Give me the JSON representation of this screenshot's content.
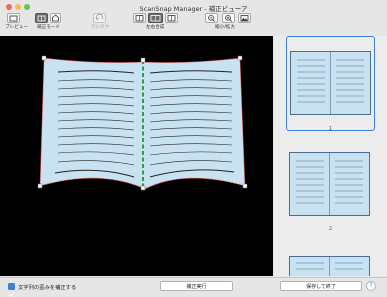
{
  "window": {
    "title": "ScanSnap Manager - 補正ビューア"
  },
  "toolbar": {
    "preview_label": "プレビュー",
    "correction_mode_label": "補正モード",
    "undo_label": "元に戻す",
    "page_compose_label": "左右合成",
    "zoom_label": "縮小/拡大"
  },
  "thumbnails": {
    "items": [
      {
        "number": "1",
        "selected": true
      },
      {
        "number": "2",
        "selected": false
      }
    ]
  },
  "bottom": {
    "checkbox_label": "文字列の歪みを補正する",
    "checkbox_checked": true,
    "apply_button": "補正実行",
    "save_button": "保存して終了",
    "help_icon": "?"
  },
  "colors": {
    "accent": "#3b82d6",
    "page_fill": "#c9e2f2",
    "page_outline": "#e03030",
    "spine": "#2ea043",
    "editor_bg": "#000000"
  }
}
